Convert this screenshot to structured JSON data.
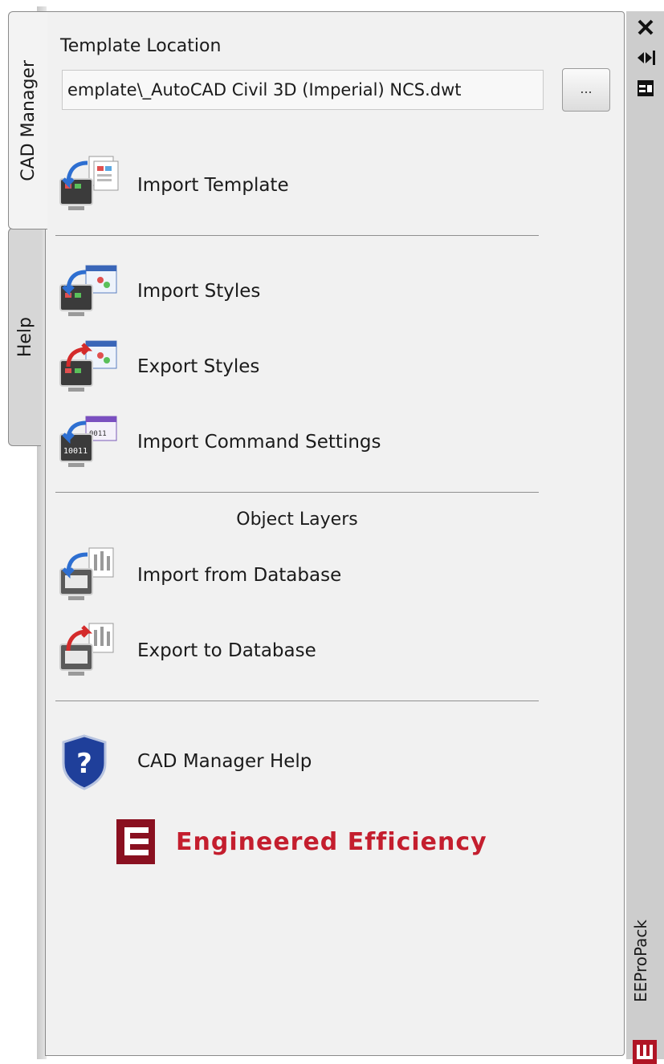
{
  "tabs": {
    "cad_manager": "CAD Manager",
    "help": "Help"
  },
  "template": {
    "label": "Template Location",
    "path_value": "emplate\\_AutoCAD Civil 3D (Imperial) NCS.dwt",
    "browse_label": "..."
  },
  "commands": {
    "import_template": "Import Template",
    "import_styles": "Import Styles",
    "export_styles": "Export Styles",
    "import_command_settings": "Import Command Settings",
    "object_layers_title": "Object Layers",
    "import_from_database": "Import from Database",
    "export_to_database": "Export to Database",
    "help": "CAD Manager Help"
  },
  "brand": {
    "name": "Engineered Efficiency",
    "color": "#c41e2e"
  },
  "side_strip": {
    "title": "EEProPack",
    "icons": [
      "close-icon",
      "auto-hide-icon",
      "properties-icon"
    ]
  },
  "colors": {
    "panel_bg": "#f1f1f1",
    "strip_bg": "#cdcdcd",
    "arrow_blue": "#2e6fd1",
    "arrow_red": "#d42b2b"
  }
}
